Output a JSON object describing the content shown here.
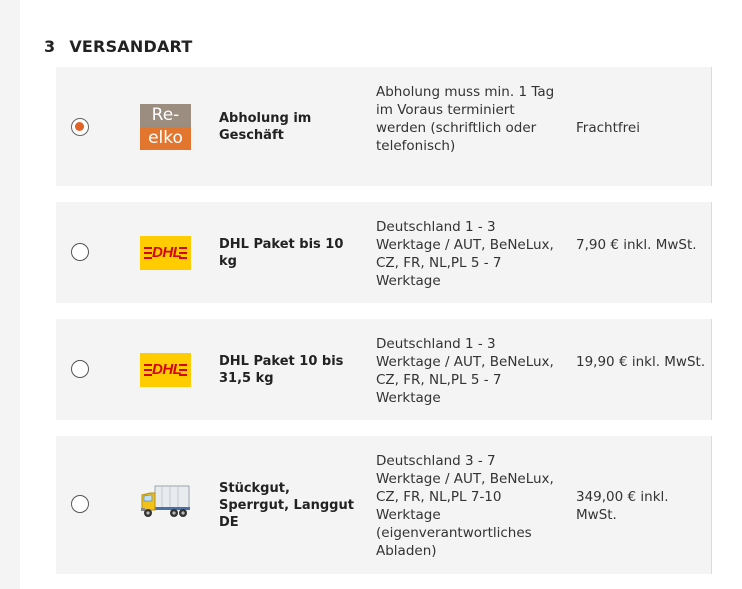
{
  "section": {
    "number": "3",
    "title": "VERSANDART"
  },
  "options": [
    {
      "selected": true,
      "logo": {
        "type": "re-elko",
        "line1": "Re-",
        "line2": "elko"
      },
      "name": "Abholung im Geschäft",
      "description": "Abholung muss min. 1 Tag im Voraus terminiert werden (schriftlich oder telefonisch)",
      "price": "Frachtfrei"
    },
    {
      "selected": false,
      "logo": {
        "type": "dhl",
        "text": "DHL"
      },
      "name": "DHL Paket bis 10 kg",
      "description": "Deutschland 1 - 3 Werktage / AUT, BeNeLux, CZ, FR, NL,PL 5 - 7 Werktage",
      "price": "7,90 € inkl. MwSt."
    },
    {
      "selected": false,
      "logo": {
        "type": "dhl",
        "text": "DHL"
      },
      "name": "DHL Paket 10 bis 31,5 kg",
      "description": "Deutschland 1 - 3 Werktage / AUT, BeNeLux, CZ, FR, NL,PL 5 - 7 Werktage",
      "price": "19,90 € inkl. MwSt."
    },
    {
      "selected": false,
      "logo": {
        "type": "truck"
      },
      "name": "Stückgut, Sperrgut, Langgut DE",
      "description": "Deutschland 3 - 7 Werktage / AUT, BeNeLux, CZ, FR, NL,PL 7-10 Werktage (eigenverantwortliches Abladen)",
      "price": "349,00 € inkl. MwSt."
    }
  ],
  "colors": {
    "accent": "#e0632a",
    "dhl_yellow": "#ffcc00",
    "dhl_red": "#d40511"
  }
}
